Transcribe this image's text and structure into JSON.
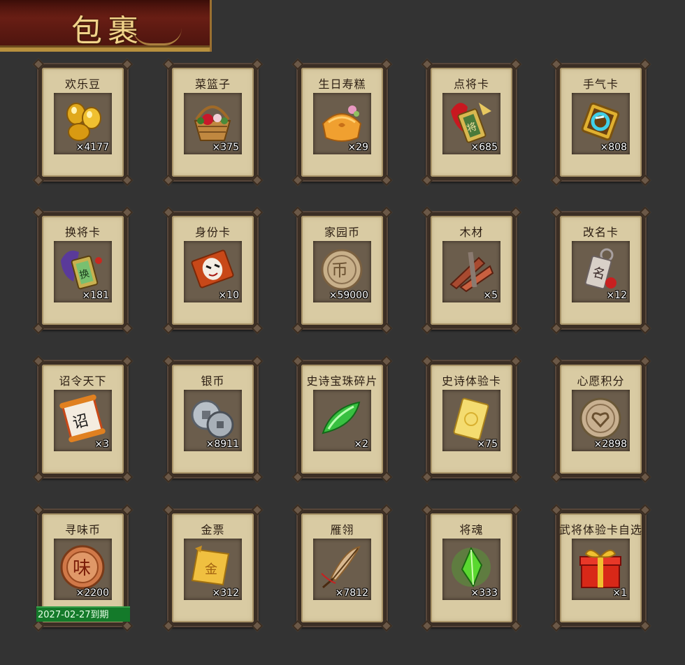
{
  "header": {
    "title": "包裹"
  },
  "items": [
    {
      "name": "欢乐豆",
      "count": "×4177",
      "icon": "golden-beans-icon"
    },
    {
      "name": "菜篮子",
      "count": "×375",
      "icon": "flower-basket-icon"
    },
    {
      "name": "生日寿糕",
      "count": "×29",
      "icon": "birthday-cake-icon"
    },
    {
      "name": "点将卡",
      "count": "×685",
      "icon": "general-pick-card-icon"
    },
    {
      "name": "手气卡",
      "count": "×808",
      "icon": "luck-card-icon"
    },
    {
      "name": "换将卡",
      "count": "×181",
      "icon": "swap-general-card-icon"
    },
    {
      "name": "身份卡",
      "count": "×10",
      "icon": "identity-card-icon"
    },
    {
      "name": "家园币",
      "count": "×59000",
      "icon": "home-coin-icon"
    },
    {
      "name": "木材",
      "count": "×5",
      "icon": "wood-icon"
    },
    {
      "name": "改名卡",
      "count": "×12",
      "icon": "rename-card-icon"
    },
    {
      "name": "诏令天下",
      "count": "×3",
      "icon": "imperial-edict-icon"
    },
    {
      "name": "银币",
      "count": "×8911",
      "icon": "silver-coin-icon"
    },
    {
      "name": "史诗宝珠碎片",
      "count": "×2",
      "icon": "epic-gem-fragment-icon"
    },
    {
      "name": "史诗体验卡",
      "count": "×75",
      "icon": "epic-trial-card-icon"
    },
    {
      "name": "心愿积分",
      "count": "×2898",
      "icon": "wish-points-coin-icon"
    },
    {
      "name": "寻味币",
      "count": "×2200",
      "icon": "taste-coin-icon",
      "expiry": "2027-02-27到期"
    },
    {
      "name": "金票",
      "count": "×312",
      "icon": "gold-ticket-icon"
    },
    {
      "name": "雁翎",
      "count": "×7812",
      "icon": "goose-feather-icon"
    },
    {
      "name": "将魂",
      "count": "×333",
      "icon": "general-soul-crystal-icon"
    },
    {
      "name": "武将体验卡自选",
      "count": "×1",
      "icon": "gift-box-icon"
    }
  ]
}
